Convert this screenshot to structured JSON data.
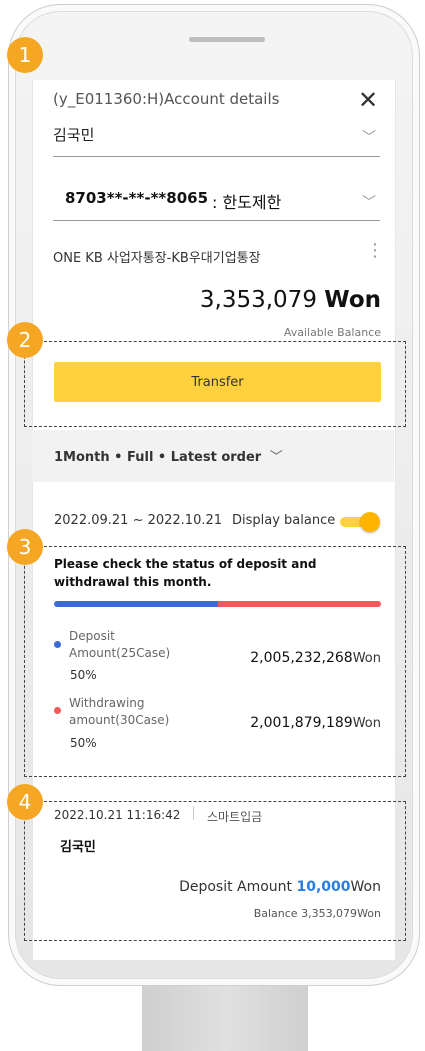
{
  "header": {
    "title": "(y_E011360:H)Account details"
  },
  "account": {
    "holder": "김국민",
    "number": "8703**-**-**8065",
    "status": ": 한도제한",
    "product": "ONE KB 사업자통장-KB우대기업통장",
    "balance": "3,353,079",
    "balance_unit": "Won",
    "available_label": "Available Balance"
  },
  "actions": {
    "transfer_label": "Transfer"
  },
  "filter": {
    "label": "1Month • Full • Latest order"
  },
  "period": {
    "range": "2022.09.21 ~ 2022.10.21",
    "display_balance_label": "Display balance",
    "display_balance_on": true
  },
  "summary": {
    "notice": "Please check the status of deposit and withdrawal this month.",
    "deposit_share": 0.5,
    "deposit": {
      "label_line1": "Deposit",
      "label_line2": "Amount(25Case)",
      "percent": "50",
      "percent_unit": "%",
      "amount": "2,005,232,268",
      "unit": "Won",
      "color": "#3b6bd6"
    },
    "withdrawal": {
      "label_line1": "Withdrawing",
      "label_line2": "amount(30Case)",
      "percent": "50",
      "percent_unit": "%",
      "amount": "2,001,879,189",
      "unit": "Won",
      "color": "#f25a5a"
    }
  },
  "transaction": {
    "datetime": "2022.10.21 11:16:42",
    "type": "스마트입금",
    "name": "김국민",
    "amount_label": "Deposit Amount",
    "amount": "10,000",
    "amount_unit": "Won",
    "balance_text": "Balance 3,353,079",
    "balance_unit": "Won"
  },
  "annotations": [
    "1",
    "2",
    "3",
    "4"
  ],
  "colors": {
    "accent": "#ffd23d",
    "badge": "#f5a623",
    "deposit": "#3b6bd6",
    "withdrawal": "#f25a5a",
    "link_blue": "#2a7de1"
  }
}
